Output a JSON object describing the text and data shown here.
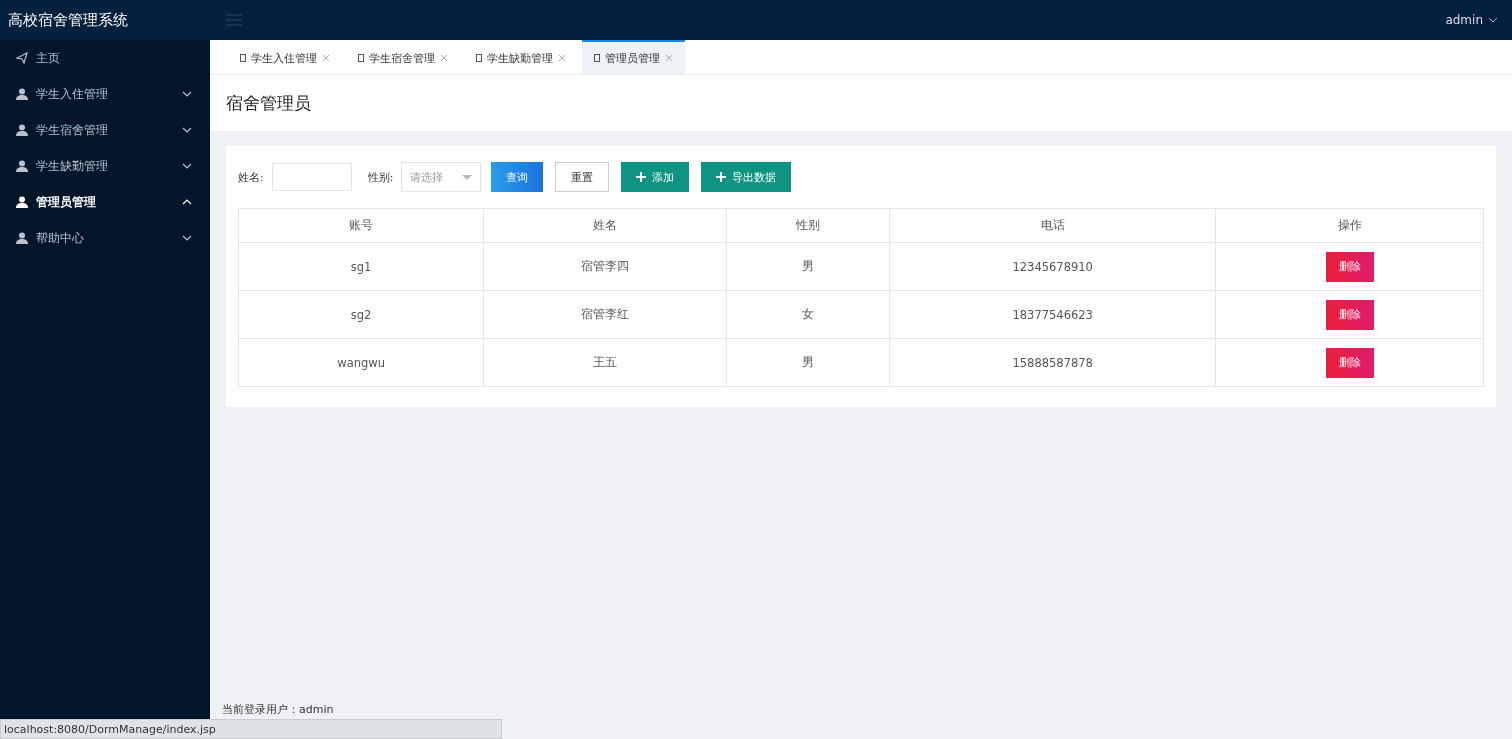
{
  "header": {
    "title": "高校宿舍管理系统",
    "user": "admin"
  },
  "sidebar": {
    "items": [
      {
        "label": "主页",
        "kind": "link",
        "selected": false
      },
      {
        "label": "学生入住管理",
        "kind": "menu",
        "expanded": false,
        "selected": false
      },
      {
        "label": "学生宿舍管理",
        "kind": "menu",
        "expanded": false,
        "selected": false
      },
      {
        "label": "学生缺勤管理",
        "kind": "menu",
        "expanded": false,
        "selected": false
      },
      {
        "label": "管理员管理",
        "kind": "menu",
        "expanded": true,
        "selected": true
      },
      {
        "label": "帮助中心",
        "kind": "menu",
        "expanded": false,
        "selected": false
      }
    ]
  },
  "tabs": [
    {
      "label": "学生入住管理",
      "selected": false
    },
    {
      "label": "学生宿舍管理",
      "selected": false
    },
    {
      "label": "学生缺勤管理",
      "selected": false
    },
    {
      "label": "管理员管理",
      "selected": true
    }
  ],
  "page_title": "宿舍管理员",
  "filters": {
    "name_label": "姓名:",
    "gender_label": "性别:",
    "gender_placeholder": "请选择"
  },
  "buttons": [
    {
      "label": "查询",
      "kind": "query"
    },
    {
      "label": "重置",
      "kind": "reset"
    },
    {
      "label": "添加",
      "kind": "add"
    },
    {
      "label": "导出数据",
      "kind": "add"
    }
  ],
  "table": {
    "columns": [
      "账号",
      "姓名",
      "性别",
      "电话",
      "操作"
    ],
    "rows": [
      {
        "account": "sg1",
        "name": "宿管李四",
        "gender": "男",
        "phone": "12345678910",
        "action": "删除"
      },
      {
        "account": "sg2",
        "name": "宿管李红",
        "gender": "女",
        "phone": "18377546623",
        "action": "删除"
      },
      {
        "account": "wangwu",
        "name": "王五",
        "gender": "男",
        "phone": "15888587878",
        "action": "删除"
      }
    ]
  },
  "footer": {
    "label": "当前登录用户：",
    "user": "admin"
  },
  "status_bar": "localhost:8080/DormManage/index.jsp"
}
